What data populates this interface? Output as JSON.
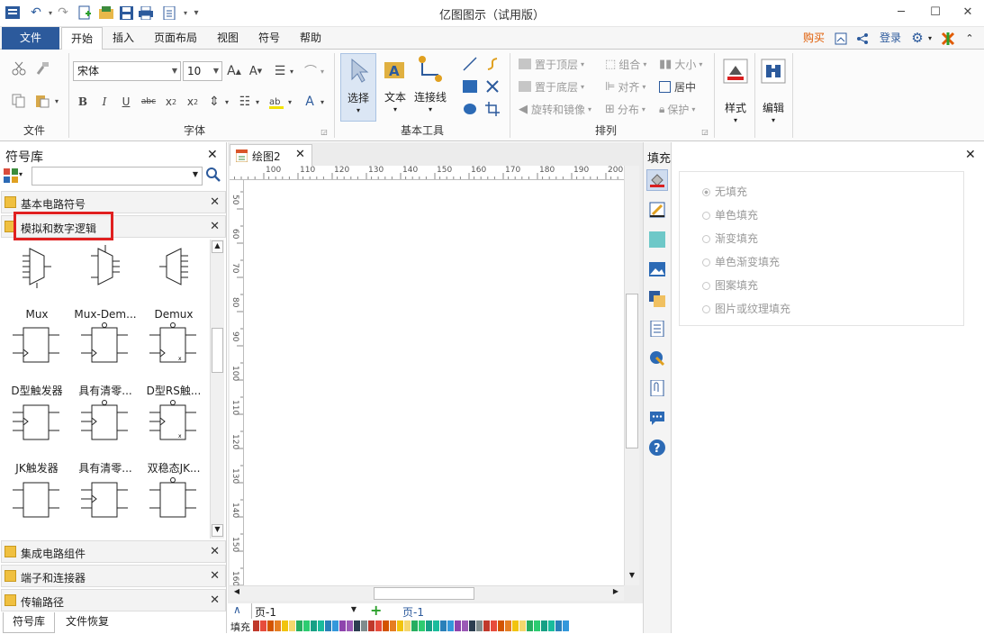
{
  "window": {
    "title": "亿图图示（试用版）"
  },
  "menu": {
    "file": "文件",
    "tabs": [
      "开始",
      "插入",
      "页面布局",
      "视图",
      "符号",
      "帮助"
    ],
    "right": {
      "buy": "购买",
      "login": "登录"
    }
  },
  "ribbon": {
    "groups": {
      "file": "文件",
      "font": "字体",
      "basic_tools": "基本工具",
      "arrange": "排列"
    },
    "font_name": "宋体",
    "font_size": "10",
    "tools": {
      "select": "选择",
      "text": "文本",
      "connector": "连接线"
    },
    "arrange": {
      "bring_front": "置于顶层",
      "send_back": "置于底层",
      "rotate_mirror": "旋转和镜像",
      "group": "组合",
      "align": "对齐",
      "distribute": "分布",
      "size": "大小",
      "center": "居中",
      "protect": "保护"
    },
    "style": "样式",
    "edit": "编辑"
  },
  "left_panel": {
    "title": "符号库",
    "search_placeholder": "",
    "libraries_top": [
      "基本电路符号",
      "模拟和数字逻辑"
    ],
    "shapes": [
      "Mux",
      "Mux-Dem...",
      "Demux",
      "D型触发器",
      "具有清零...",
      "D型RS触...",
      "JK触发器",
      "具有清零...",
      "双稳态JK...",
      "",
      "",
      ""
    ],
    "libraries_bottom": [
      "集成电路组件",
      "端子和连接器",
      "传输路径"
    ],
    "bottom_tabs": [
      "符号库",
      "文件恢复"
    ]
  },
  "document": {
    "tab_title": "绘图2",
    "ruler_h": [
      "100",
      "110",
      "120",
      "130",
      "140",
      "150",
      "160",
      "170",
      "180",
      "190",
      "200"
    ],
    "ruler_v": [
      "50",
      "60",
      "70",
      "80",
      "90",
      "100",
      "110",
      "120",
      "130",
      "140",
      "150",
      "160"
    ],
    "page_select": "页-1",
    "page_tab": "页-1",
    "fill_label": "填充"
  },
  "right_panel": {
    "title": "填充",
    "options": [
      "无填充",
      "单色填充",
      "渐变填充",
      "单色渐变填充",
      "图案填充",
      "图片或纹理填充"
    ]
  },
  "palette": [
    "#c0392b",
    "#e74c3c",
    "#d35400",
    "#e67e22",
    "#f1c40f",
    "#f5d76e",
    "#27ae60",
    "#2ecc71",
    "#16a085",
    "#1abc9c",
    "#2980b9",
    "#3498db",
    "#8e44ad",
    "#9b59b6",
    "#2c3e50",
    "#7f8c8d"
  ]
}
